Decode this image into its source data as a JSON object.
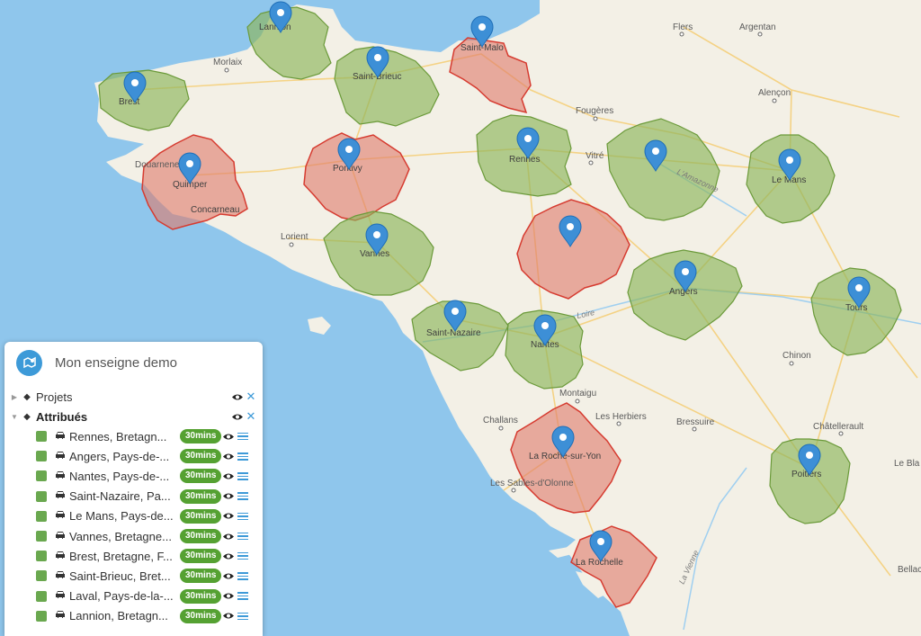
{
  "panel": {
    "title": "Mon enseigne demo",
    "groups": [
      {
        "label": "Projets",
        "expanded": false
      },
      {
        "label": "Attribués",
        "expanded": true
      }
    ],
    "items": [
      {
        "name": "Rennes, Bretagn...",
        "badge": "30mins",
        "color": "#6aa84f"
      },
      {
        "name": "Angers, Pays-de-...",
        "badge": "30mins",
        "color": "#6aa84f"
      },
      {
        "name": "Nantes, Pays-de-...",
        "badge": "30mins",
        "color": "#6aa84f"
      },
      {
        "name": "Saint-Nazaire, Pa...",
        "badge": "30mins",
        "color": "#6aa84f"
      },
      {
        "name": "Le Mans, Pays-de...",
        "badge": "30mins",
        "color": "#6aa84f"
      },
      {
        "name": "Vannes, Bretagne...",
        "badge": "30mins",
        "color": "#6aa84f"
      },
      {
        "name": "Brest, Bretagne, F...",
        "badge": "30mins",
        "color": "#6aa84f"
      },
      {
        "name": "Saint-Brieuc, Bret...",
        "badge": "30mins",
        "color": "#6aa84f"
      },
      {
        "name": "Laval, Pays-de-la-...",
        "badge": "30mins",
        "color": "#6aa84f"
      },
      {
        "name": "Lannion, Bretagn...",
        "badge": "30mins",
        "color": "#6aa84f"
      }
    ]
  },
  "map": {
    "colors": {
      "sea": "#8fc6ec",
      "land": "#f3f0e6",
      "assigned": "#8cb55a",
      "project": "#e07a6a",
      "marker": "#3d8fd6"
    },
    "labels": {
      "lannion": "Lannion",
      "morlaix": "Morlaix",
      "saint_brieuc": "Saint-Brieuc",
      "saint_malo": "Saint-Malo",
      "flers": "Flers",
      "argentan": "Argentan",
      "alencon": "Alençon",
      "fougeres": "Fougères",
      "brest": "Brest",
      "douarnenez": "Douarnenez",
      "quimper": "Quimper",
      "concarneau": "Concarneau",
      "pontivy": "Pontivy",
      "rennes": "Rennes",
      "vitre": "Vitré",
      "le_mans": "Le Mans",
      "lorient": "Lorient",
      "vannes": "Vannes",
      "angers": "Angers",
      "tours": "Tours",
      "saint_nazaire": "Saint-Nazaire",
      "nantes": "Nantes",
      "chinon": "Chinon",
      "montaigu": "Montaigu",
      "challans": "Challans",
      "les_herbiers": "Les Herbiers",
      "bressuire": "Bressuire",
      "chatellerault": "Châtellerault",
      "la_roche": "La Roche-sur-Yon",
      "les_sables": "Les Sables-d'Olonne",
      "poitiers": "Poitiers",
      "la_rochelle": "La Rochelle",
      "le_blanc": "Le Bla",
      "bellac": "Bellac",
      "loire": "Loire",
      "amazon": "L'Amazonne",
      "vienne": "La Vienne"
    }
  }
}
